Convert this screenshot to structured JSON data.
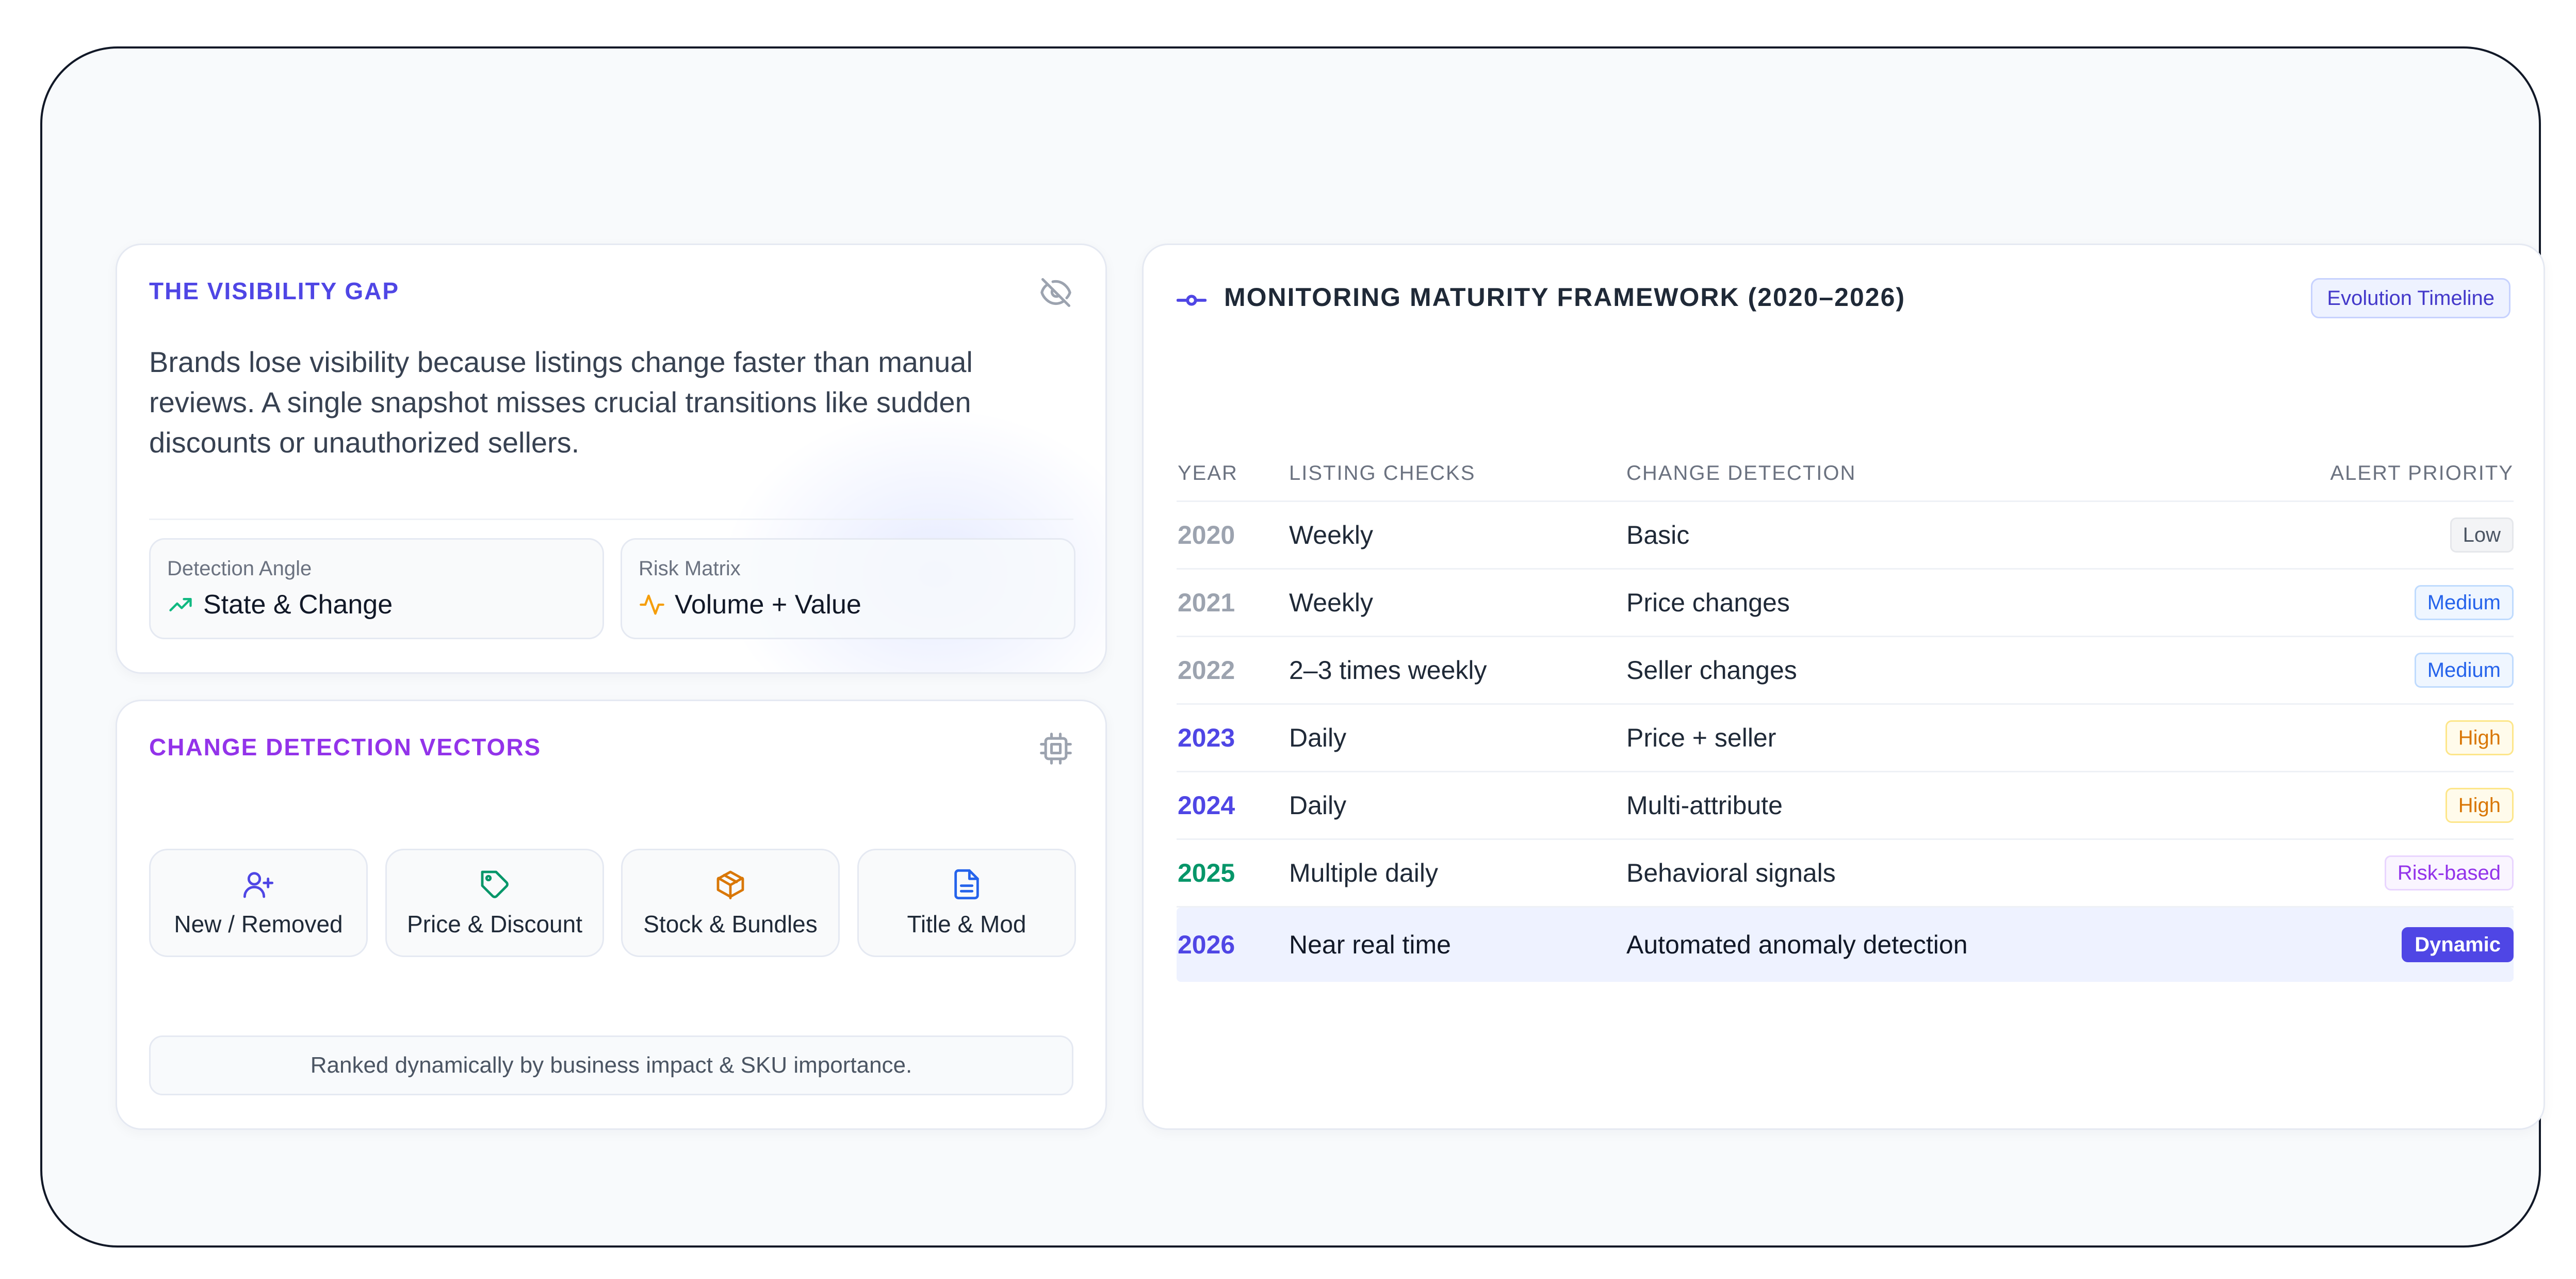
{
  "visibility_gap": {
    "title": "THE VISIBILITY GAP",
    "icon": "eye-off-icon",
    "body": "Brands lose visibility because listings change faster than manual reviews. A single snapshot misses crucial transitions like sudden discounts or unauthorized sellers.",
    "stats": [
      {
        "label": "Detection Angle",
        "value": "State & Change",
        "icon": "trending-up-icon",
        "icon_color": "#10b981"
      },
      {
        "label": "Risk Matrix",
        "value": "Volume + Value",
        "icon": "activity-icon",
        "icon_color": "#f59e0b"
      }
    ]
  },
  "change_vectors": {
    "title": "CHANGE DETECTION VECTORS",
    "icon": "cpu-chip-icon",
    "vectors": [
      {
        "label": "New / Removed",
        "icon": "user-plus-icon",
        "color": "#4f46e5"
      },
      {
        "label": "Price & Discount",
        "icon": "tag-icon",
        "color": "#059669"
      },
      {
        "label": "Stock & Bundles",
        "icon": "package-icon",
        "color": "#d97706"
      },
      {
        "label": "Title & Mod",
        "icon": "document-icon",
        "color": "#2563eb"
      }
    ],
    "note": "Ranked dynamically by business impact & SKU importance."
  },
  "framework": {
    "title": "MONITORING MATURITY FRAMEWORK (2020–2026)",
    "icon": "timeline-icon",
    "badge": "Evolution Timeline",
    "headers": [
      "YEAR",
      "LISTING CHECKS",
      "CHANGE DETECTION",
      "ALERT PRIORITY"
    ],
    "rows": [
      {
        "year": "2020",
        "checks": "Weekly",
        "change": "Basic",
        "alert": "Low",
        "alert_style": "low",
        "year_color": "#9ca3af"
      },
      {
        "year": "2021",
        "checks": "Weekly",
        "change": "Price changes",
        "alert": "Medium",
        "alert_style": "medium",
        "year_color": "#9ca3af"
      },
      {
        "year": "2022",
        "checks": "2–3 times weekly",
        "change": "Seller changes",
        "alert": "Medium",
        "alert_style": "medium",
        "year_color": "#9ca3af"
      },
      {
        "year": "2023",
        "checks": "Daily",
        "change": "Price + seller",
        "alert": "High",
        "alert_style": "high",
        "year_color": "#4f46e5"
      },
      {
        "year": "2024",
        "checks": "Daily",
        "change": "Multi-attribute",
        "alert": "High",
        "alert_style": "high",
        "year_color": "#4f46e5"
      },
      {
        "year": "2025",
        "checks": "Multiple daily",
        "change": "Behavioral signals",
        "alert": "Risk-based",
        "alert_style": "risk",
        "year_color": "#059669"
      },
      {
        "year": "2026",
        "checks": "Near real time",
        "change": "Automated anomaly detection",
        "alert": "Dynamic",
        "alert_style": "dynamic",
        "year_color": "#4f46e5",
        "highlighted": true
      }
    ]
  }
}
